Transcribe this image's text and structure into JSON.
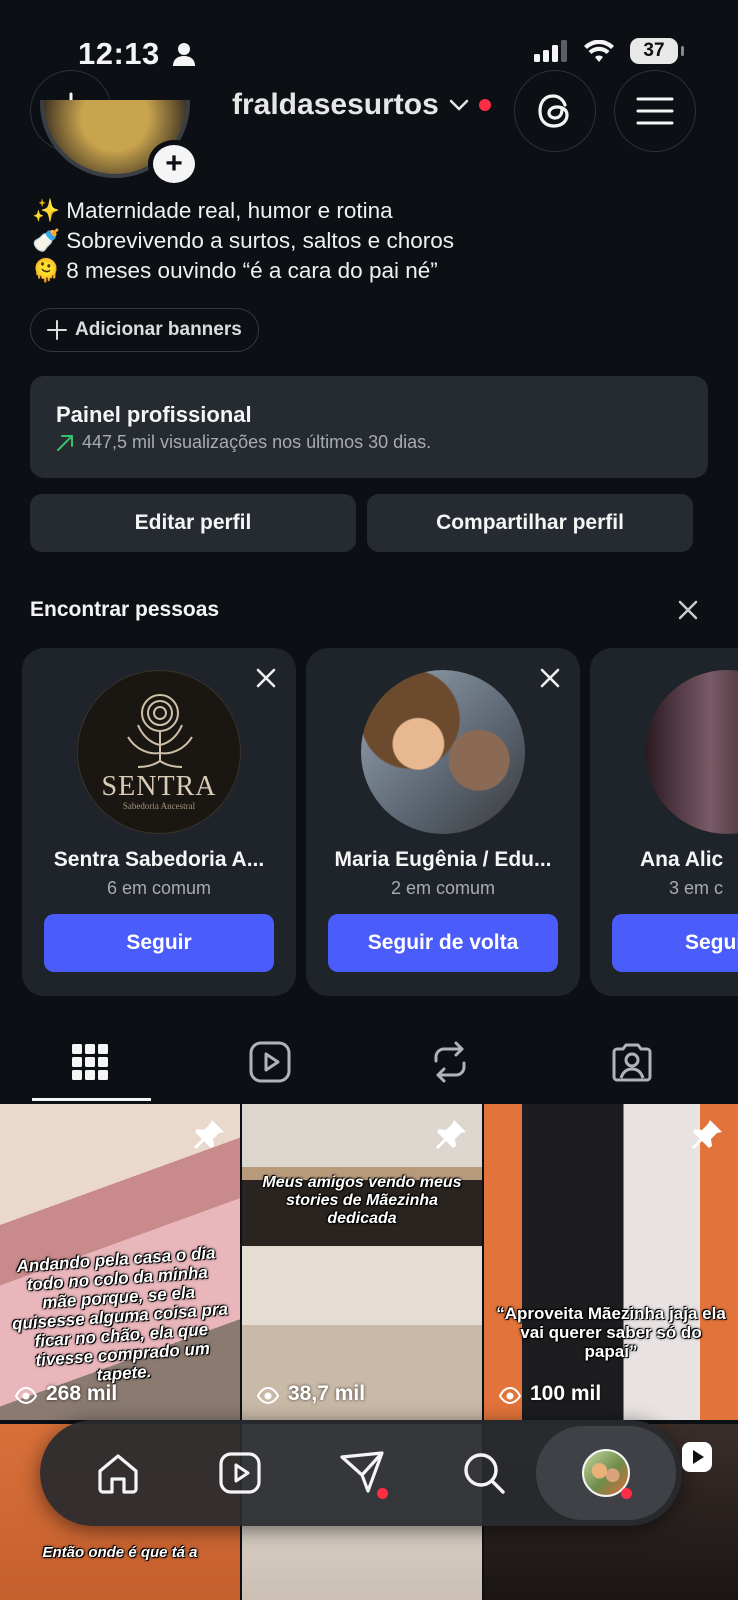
{
  "status": {
    "time": "12:13",
    "battery": "37"
  },
  "header": {
    "username": "fraldasesurtos"
  },
  "bio": {
    "lines": [
      "✨ Maternidade real, humor e rotina",
      "🍼 Sobrevivendo a surtos, saltos e choros",
      "🫠 8 meses ouvindo “é a cara do pai né”"
    ],
    "add_banners": "Adicionar banners"
  },
  "dashboard": {
    "title": "Painel profissional",
    "subtitle": "447,5 mil visualizações nos últimos 30 dias."
  },
  "profile_buttons": {
    "edit": "Editar perfil",
    "share": "Compartilhar perfil"
  },
  "suggestions": {
    "title": "Encontrar pessoas",
    "cards": [
      {
        "name": "Sentra Sabedoria A...",
        "mutual": "6 em comum",
        "button": "Seguir",
        "logo_text": "SENTRA",
        "logo_sub": "Sabedoria Ancestral"
      },
      {
        "name": "Maria Eugênia / Edu...",
        "mutual": "2 em comum",
        "button": "Seguir de volta"
      },
      {
        "name": "Ana Alic",
        "mutual": "3 em c",
        "button": "Seguir d"
      }
    ]
  },
  "tabs": [
    "grid-icon",
    "reels-icon",
    "reposts-icon",
    "tagged-icon"
  ],
  "posts": [
    {
      "caption": "Andando pela casa o dia todo no colo da minha mãe porque, se ela quisesse alguma coisa pra ficar no chão, ela que tivesse comprado um tapete.",
      "views": "268 mil"
    },
    {
      "caption": "Meus amigos vendo meus stories de Mãezinha dedicada",
      "views": "38,7 mil"
    },
    {
      "caption": "“Aproveita Mãezinha jaja ela vai querer saber só do papai”",
      "views": "100 mil"
    }
  ],
  "posts_row2": [
    {
      "caption": "Então onde é que tá a"
    }
  ],
  "bottom_nav": [
    "home-icon",
    "reels-icon",
    "messages-icon",
    "search-icon",
    "profile-avatar"
  ],
  "colors": {
    "accent": "#4a5dfa",
    "background": "#0c1014",
    "card": "#262a31",
    "notification": "#ff2d45"
  }
}
